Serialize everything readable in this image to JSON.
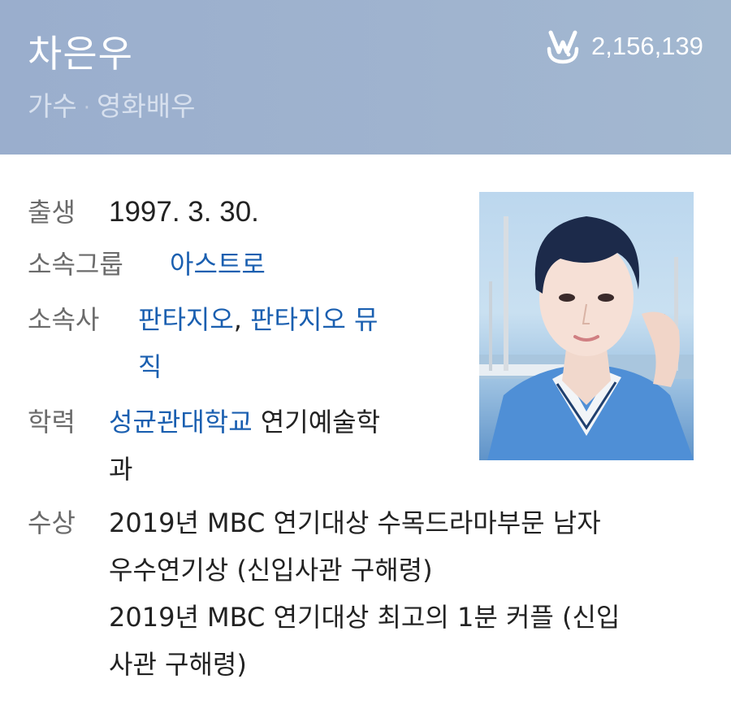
{
  "header": {
    "name": "차은우",
    "occupations": [
      "가수",
      "영화배우"
    ],
    "separator": "·",
    "vlive_count": "2,156,139"
  },
  "profile": {
    "birth": {
      "label": "출생",
      "value": "1997. 3. 30."
    },
    "group": {
      "label": "소속그룹",
      "value": "아스트로"
    },
    "agency": {
      "label": "소속사",
      "value_1": "판타지오",
      "comma": ",",
      "value_2_line1": "판타지오 뮤",
      "value_2_line2": "직"
    },
    "education": {
      "label": "학력",
      "school": "성균관대학교",
      "major_line1": "연기예술학",
      "major_line2": "과"
    },
    "awards": {
      "label": "수상",
      "lines": [
        "2019년 MBC 연기대상 수목드라마부문 남자",
        "우수연기상 (신입사관 구해령)",
        "2019년 MBC 연기대상 최고의 1분 커플 (신입",
        "사관 구해령)"
      ]
    }
  },
  "icons": {
    "vlive": "v-live-icon",
    "photo": "profile-photo"
  },
  "colors": {
    "header_bg": "#9fb3cf",
    "link": "#1a5fb0",
    "label": "#6b6b6b"
  }
}
